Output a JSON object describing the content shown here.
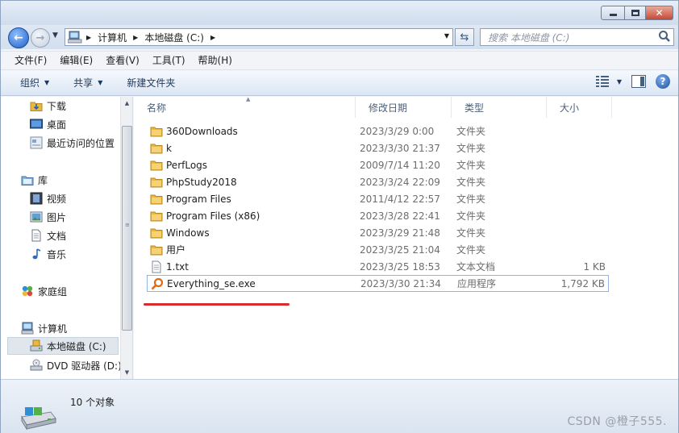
{
  "window": {
    "caption_buttons": {
      "min": "minimize",
      "max": "maximize",
      "close": "close"
    }
  },
  "address_bar": {
    "segments": [
      "计算机",
      "本地磁盘 (C:)"
    ],
    "search_placeholder": "搜索 本地磁盘 (C:)"
  },
  "menu": [
    "文件(F)",
    "编辑(E)",
    "查看(V)",
    "工具(T)",
    "帮助(H)"
  ],
  "toolbar": {
    "organize": "组织",
    "share": "共享",
    "new_folder": "新建文件夹"
  },
  "nav_pane": {
    "items": [
      {
        "label": "下载",
        "icon": "download-folder-icon"
      },
      {
        "label": "桌面",
        "icon": "desktop-icon"
      },
      {
        "label": "最近访问的位置",
        "icon": "recent-places-icon"
      },
      {
        "label": "库",
        "icon": "library-icon"
      },
      {
        "label": "视频",
        "icon": "video-library-icon"
      },
      {
        "label": "图片",
        "icon": "picture-library-icon"
      },
      {
        "label": "文档",
        "icon": "document-library-icon"
      },
      {
        "label": "音乐",
        "icon": "music-library-icon"
      },
      {
        "label": "家庭组",
        "icon": "homegroup-icon"
      },
      {
        "label": "计算机",
        "icon": "computer-icon"
      },
      {
        "label": "本地磁盘 (C:)",
        "icon": "local-disk-icon"
      },
      {
        "label": "DVD 驱动器 (D:)",
        "icon": "dvd-drive-icon"
      }
    ]
  },
  "columns": {
    "name": "名称",
    "date": "修改日期",
    "type": "类型",
    "size": "大小"
  },
  "files": [
    {
      "name": "360Downloads",
      "date": "2023/3/29 0:00",
      "type": "文件夹",
      "size": "",
      "icon": "folder-icon"
    },
    {
      "name": "k",
      "date": "2023/3/30 21:37",
      "type": "文件夹",
      "size": "",
      "icon": "folder-icon"
    },
    {
      "name": "PerfLogs",
      "date": "2009/7/14 11:20",
      "type": "文件夹",
      "size": "",
      "icon": "folder-icon"
    },
    {
      "name": "PhpStudy2018",
      "date": "2023/3/24 22:09",
      "type": "文件夹",
      "size": "",
      "icon": "folder-icon"
    },
    {
      "name": "Program Files",
      "date": "2011/4/12 22:57",
      "type": "文件夹",
      "size": "",
      "icon": "folder-icon"
    },
    {
      "name": "Program Files (x86)",
      "date": "2023/3/28 22:41",
      "type": "文件夹",
      "size": "",
      "icon": "folder-icon"
    },
    {
      "name": "Windows",
      "date": "2023/3/29 21:48",
      "type": "文件夹",
      "size": "",
      "icon": "folder-icon"
    },
    {
      "name": "用户",
      "date": "2023/3/25 21:04",
      "type": "文件夹",
      "size": "",
      "icon": "folder-icon"
    },
    {
      "name": "1.txt",
      "date": "2023/3/25 18:53",
      "type": "文本文档",
      "size": "1 KB",
      "icon": "text-file-icon"
    },
    {
      "name": "Everything_se.exe",
      "date": "2023/3/30 21:34",
      "type": "应用程序",
      "size": "1,792 KB",
      "icon": "everything-app-icon"
    }
  ],
  "status": {
    "count_text": "10 个对象",
    "watermark": "CSDN @橙子555."
  },
  "colors": {
    "highlight_underline": "#d92b2b",
    "selection_border": "#8fb7e2",
    "folder": "#e8b83f"
  }
}
